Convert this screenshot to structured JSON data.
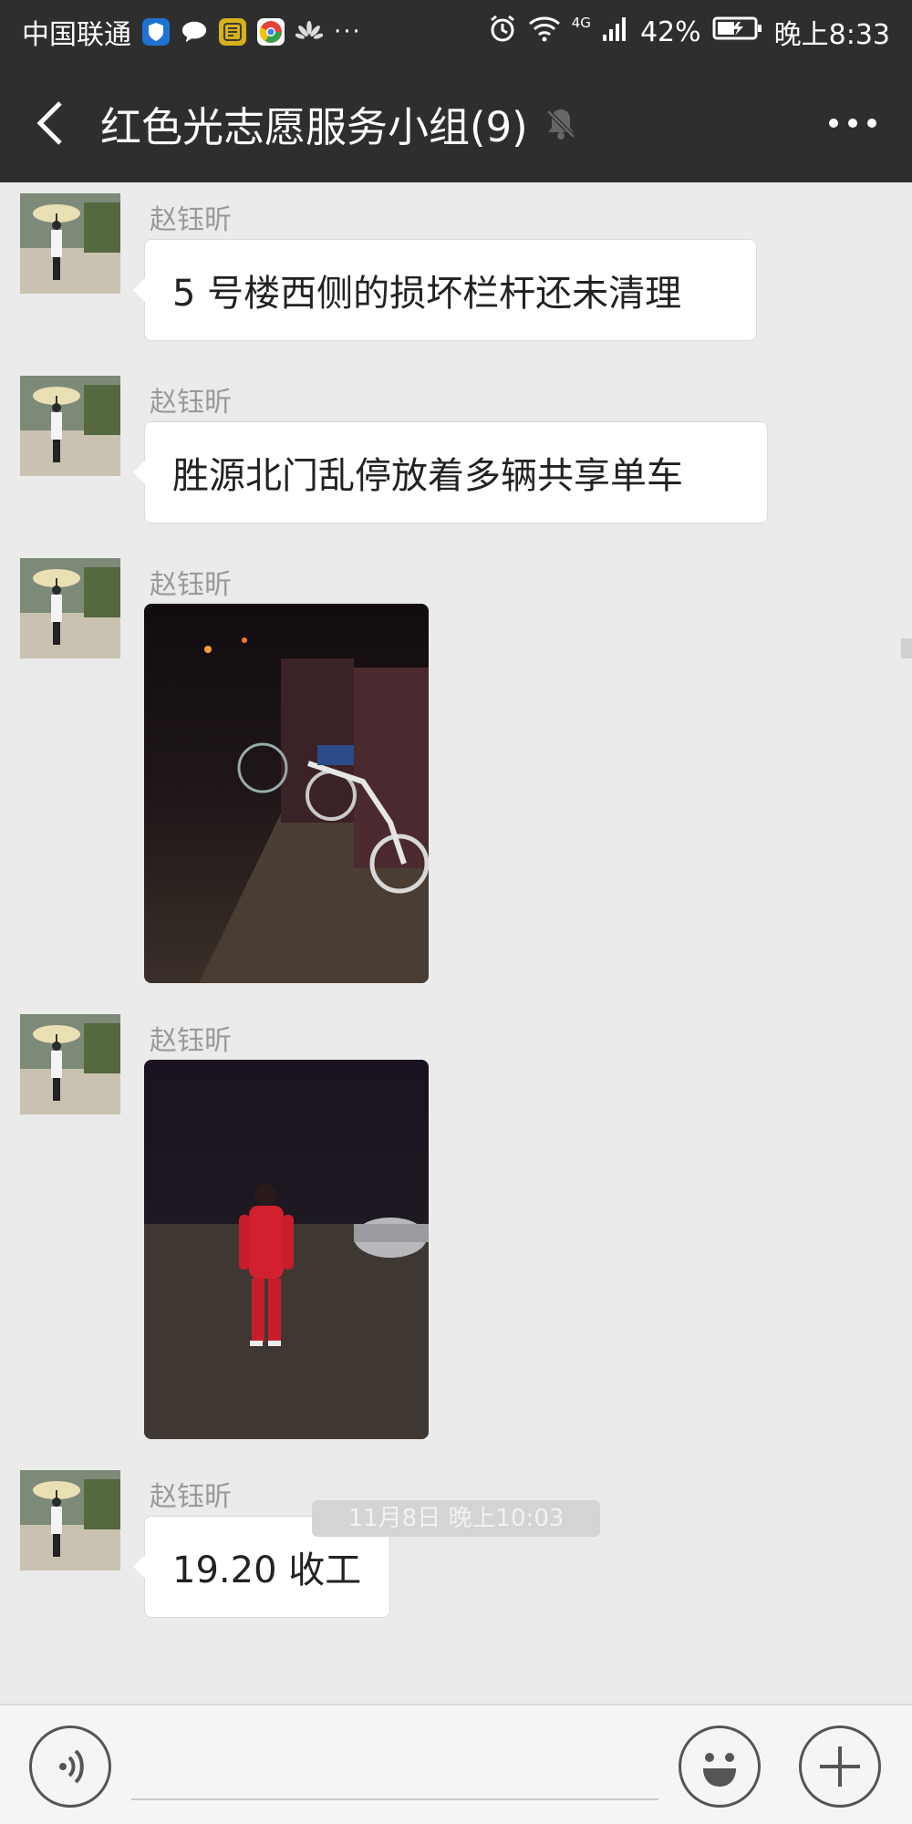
{
  "status_bar": {
    "carrier": "中国联通",
    "more": "···",
    "network": "4G",
    "battery": "42%",
    "time": "晚上8:33"
  },
  "header": {
    "title": "红色光志愿服务小组(9)"
  },
  "messages": [
    {
      "sender": "赵钰昕",
      "type": "text",
      "text": "5 号楼西侧的损坏栏杆还未清理"
    },
    {
      "sender": "赵钰昕",
      "type": "text",
      "text": "胜源北门乱停放着多辆共享单车"
    },
    {
      "sender": "赵钰昕",
      "type": "image",
      "image_desc": "bikes"
    },
    {
      "sender": "赵钰昕",
      "type": "image",
      "image_desc": "person"
    },
    {
      "sender": "赵钰昕",
      "type": "text",
      "text": "19.20 收工"
    }
  ],
  "timestamp_chip": "11月8日 晚上10:03",
  "colors": {
    "header_bg": "#2e2e2e",
    "chat_bg": "#ebebeb",
    "bubble_bg": "#ffffff",
    "sender_text": "#9a9a9a"
  }
}
